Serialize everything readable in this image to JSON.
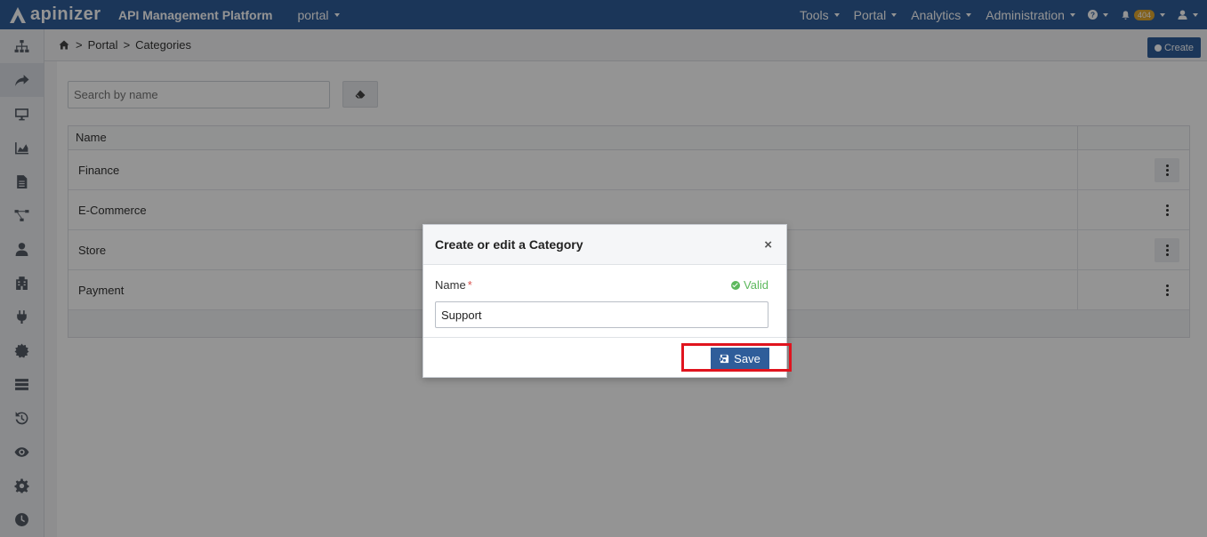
{
  "topbar": {
    "logo_text": "apinizer",
    "app_title": "API Management Platform",
    "environment": "portal",
    "nav": [
      {
        "label": "Tools"
      },
      {
        "label": "Portal"
      },
      {
        "label": "Analytics"
      },
      {
        "label": "Administration"
      }
    ],
    "notification_badge": "404",
    "brand_color": "#2f5d9a"
  },
  "sidebar": {
    "items": [
      {
        "icon": "sitemap-icon"
      },
      {
        "icon": "share-arrow-icon",
        "active": true
      },
      {
        "icon": "monitor-icon"
      },
      {
        "icon": "area-chart-icon"
      },
      {
        "icon": "document-icon"
      },
      {
        "icon": "flow-icon"
      },
      {
        "icon": "user-icon"
      },
      {
        "icon": "building-icon"
      },
      {
        "icon": "plug-icon"
      },
      {
        "icon": "gear-badge-icon"
      },
      {
        "icon": "server-icon"
      },
      {
        "icon": "history-icon"
      },
      {
        "icon": "eye-icon"
      },
      {
        "icon": "cog-icon"
      },
      {
        "icon": "clock-icon"
      }
    ]
  },
  "breadcrumb": {
    "items": [
      "Portal",
      "Categories"
    ]
  },
  "toolbar": {
    "create_label": "Create"
  },
  "search": {
    "placeholder": "Search by name"
  },
  "table": {
    "header_name": "Name",
    "rows": [
      {
        "name": "Finance"
      },
      {
        "name": "E-Commerce"
      },
      {
        "name": "Store"
      },
      {
        "name": "Payment"
      }
    ]
  },
  "modal": {
    "title": "Create or edit a Category",
    "close": "×",
    "field_label": "Name",
    "required_mark": "*",
    "valid_text": "Valid",
    "name_value": "Support",
    "save_label": "Save"
  }
}
